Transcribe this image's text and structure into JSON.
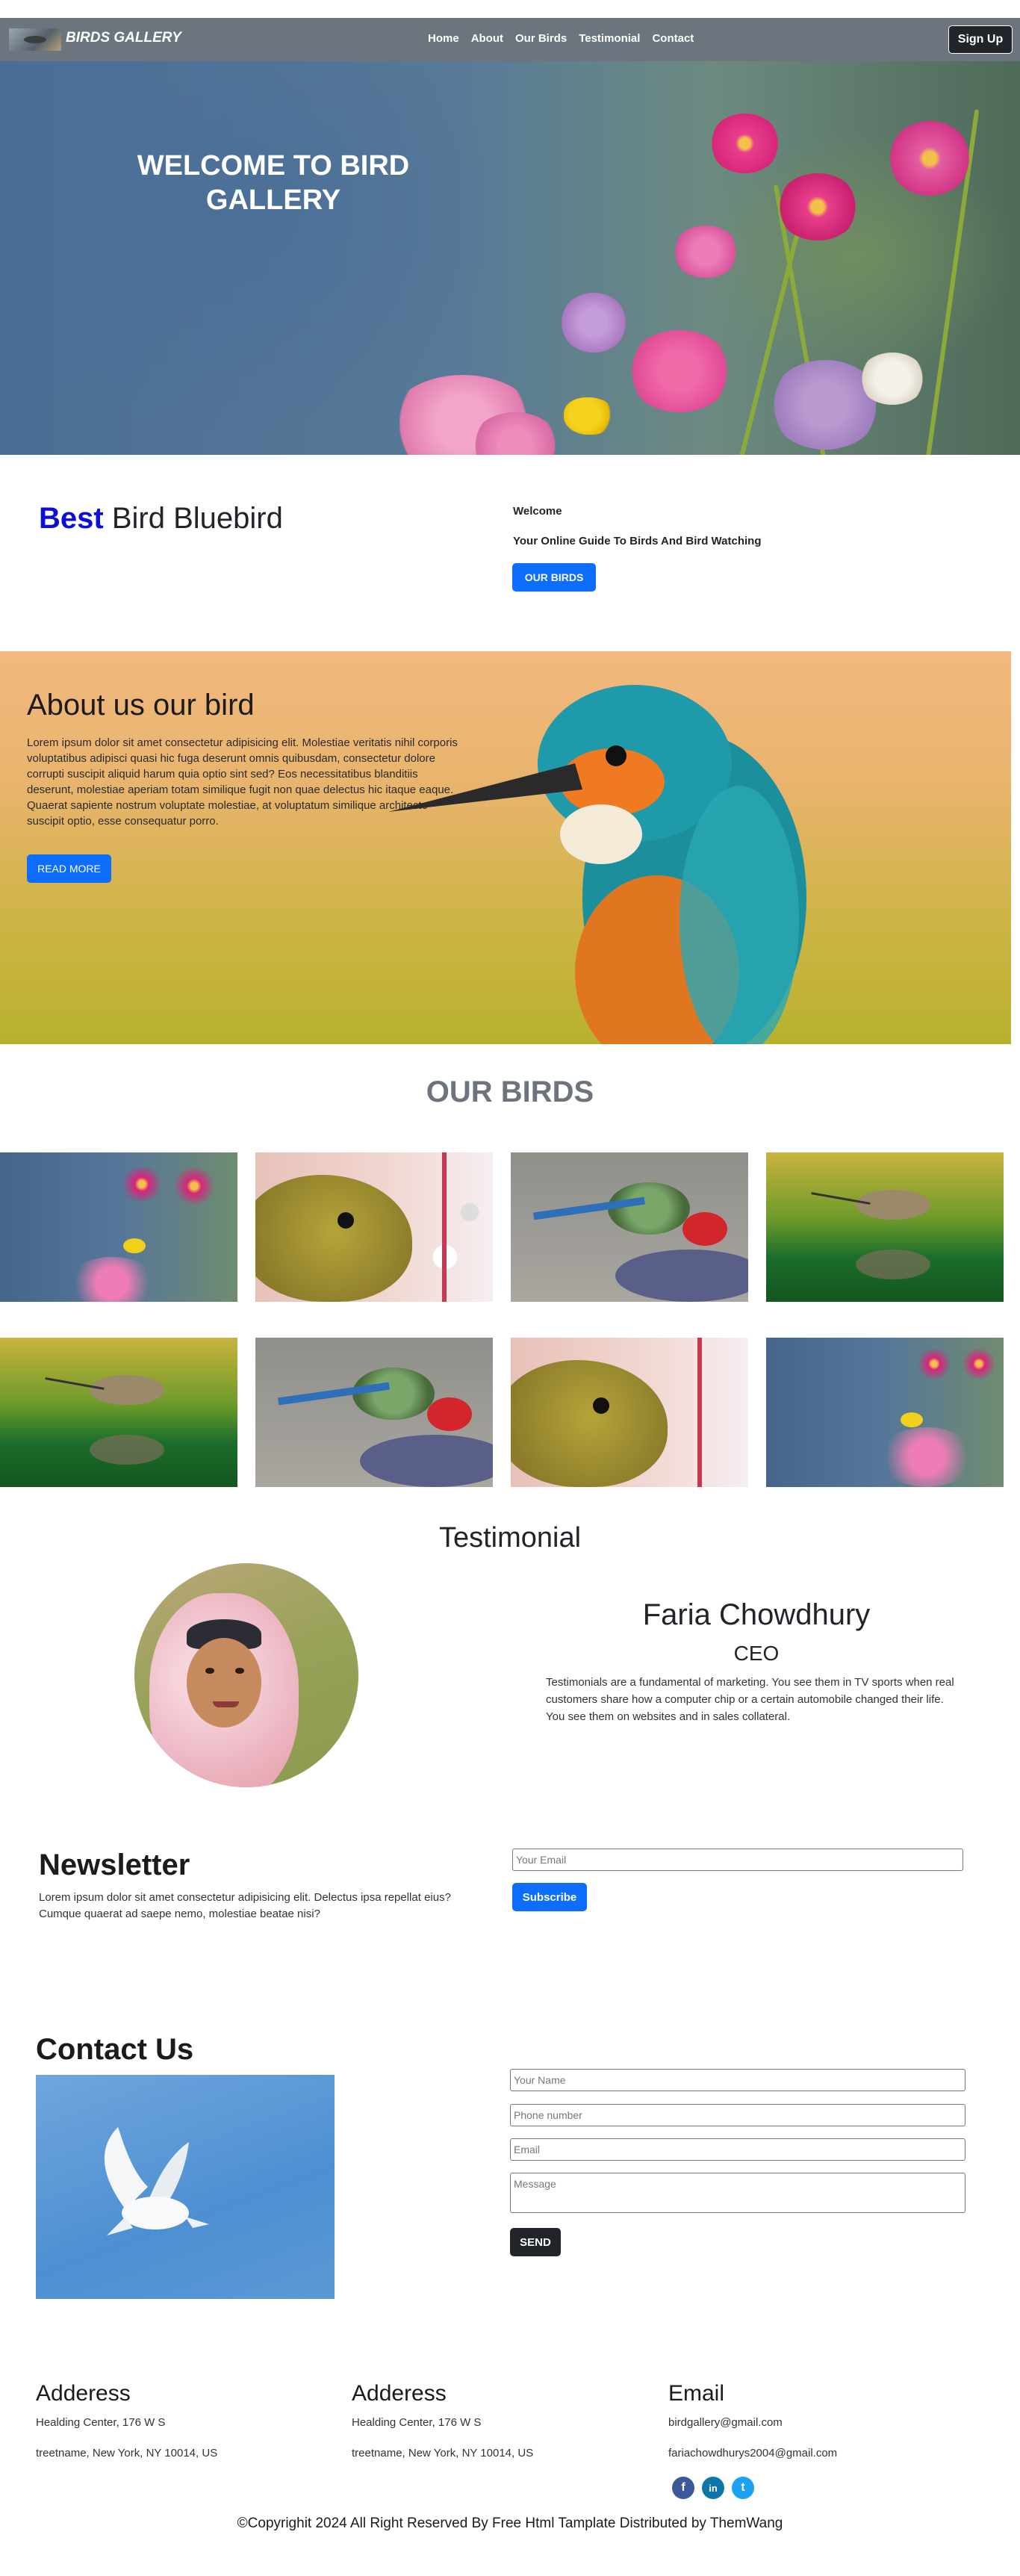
{
  "nav": {
    "brand": "BIRDS GALLERY",
    "links": [
      "Home",
      "About",
      "Our Birds",
      "Testimonial",
      "Contact"
    ],
    "signup": "Sign Up"
  },
  "hero": {
    "title": "WELCOME TO BIRD GALLERY"
  },
  "best": {
    "title_highlight": "Best",
    "title_rest": " Bird Bluebird",
    "welcome": "Welcome",
    "guide": "Your Online Guide To Birds And Bird Watching",
    "button": "OUR BIRDS"
  },
  "about": {
    "title": "About us our bird",
    "text": "Lorem ipsum dolor sit amet consectetur adipisicing elit. Molestiae veritatis nihil corporis voluptatibus adipisci quasi hic fuga deserunt omnis quibusdam, consectetur dolore corrupti suscipit aliquid harum quia optio sint sed? Eos necessitatibus blanditiis deserunt, molestiae aperiam totam similique fugit non quae delectus hic itaque eaque. Quaerat sapiente nostrum voluptate molestiae, at voluptatum similique architecto suscipit optio, esse consequatur porro.",
    "button": "READ MORE"
  },
  "our_birds": {
    "title": "OUR BIRDS"
  },
  "testimonial": {
    "title": "Testimonial",
    "name": "Faria Chowdhury",
    "role": "CEO",
    "text": "Testimonials are a fundamental of marketing. You see them in TV sports when real customers share how a computer chip or a certain automobile changed their life. You see them on websites and in sales collateral."
  },
  "newsletter": {
    "title": "Newsletter",
    "text": "Lorem ipsum dolor sit amet consectetur adipisicing elit. Delectus ipsa repellat eius? Cumque quaerat ad saepe nemo, molestiae beatae nisi?",
    "email_placeholder": "Your Email",
    "button": "Subscribe"
  },
  "contact": {
    "title": "Contact Us",
    "name_placeholder": "Your Name",
    "phone_placeholder": "Phone number",
    "email_placeholder": "Email",
    "message_placeholder": "Message",
    "button": "SEND"
  },
  "footer": {
    "col1": {
      "title": "Adderess",
      "line1": "Healding Center, 176 W S",
      "line2": "treetname, New York, NY 10014, US"
    },
    "col2": {
      "title": "Adderess",
      "line1": "Healding Center, 176 W S",
      "line2": "treetname, New York, NY 10014, US"
    },
    "col3": {
      "title": "Email",
      "line1": "birdgallery@gmail.com",
      "line2": "fariachowdhurys2004@gmail.com"
    },
    "social": [
      {
        "icon": "facebook-icon",
        "glyph": "f",
        "color": "#3b5998"
      },
      {
        "icon": "linkedin-icon",
        "glyph": "in",
        "color": "#0e76a8"
      },
      {
        "icon": "twitter-icon",
        "glyph": "t",
        "color": "#1da1f2"
      }
    ],
    "copyright": "©Copyrighit 2024 All Right Reserved By Free Html Tamplate Distributed by ThemWang"
  },
  "colors": {
    "nav_bg": "#6c757d",
    "primary": "#0d6efd",
    "dark": "#212529",
    "best_blue": "#0d0dd8"
  }
}
